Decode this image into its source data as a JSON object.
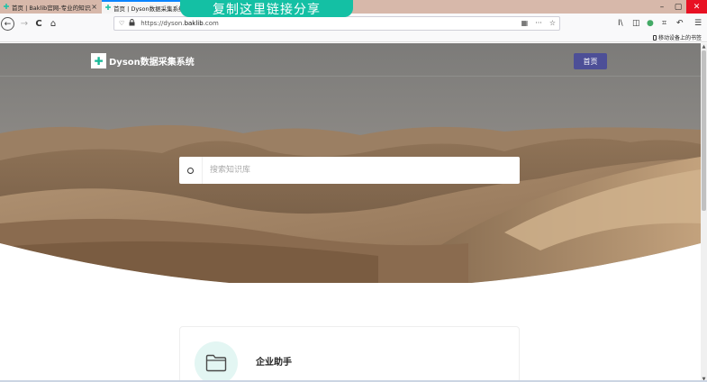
{
  "browser": {
    "tabs": [
      {
        "label": "首页 | Baklib官网-专业的知识库",
        "close": "×",
        "active": false
      },
      {
        "label": "首页 | Dyson数据采集系统",
        "close": "",
        "active": true
      }
    ],
    "overlay_banner": "复制这里链接分享",
    "window": {
      "minimize": "–",
      "maximize": "▢",
      "close": "✕"
    },
    "nav": {
      "back": "←",
      "forward": "→",
      "reload": "C",
      "home": "⌂"
    },
    "url": {
      "prefix": "https://dyson.",
      "domain": "baklib",
      "suffix": ".com",
      "shield": "♡",
      "lock": "🔒",
      "qr": "▦",
      "more": "···",
      "star": "☆"
    },
    "toolbar_right": {
      "library": "I\\",
      "sidebar": "◫",
      "account": "●",
      "screenshot": "⌗",
      "undo": "↶",
      "menu": "☰"
    },
    "bookmarks": {
      "mobile_label": "移动设备上的书签"
    }
  },
  "site": {
    "title": "Dyson数据采集系统",
    "home_button": "首页",
    "search_placeholder": "搜索知识库",
    "cards": [
      {
        "title": "企业助手",
        "icon": "folder-icon"
      }
    ]
  },
  "colors": {
    "accent": "#14c0a4",
    "home_button": "#4d4f97",
    "close_button": "#e81123"
  }
}
